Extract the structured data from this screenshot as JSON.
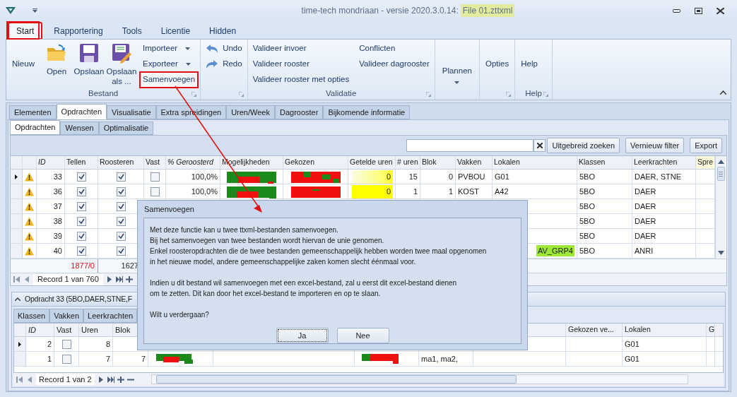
{
  "title_bar": {
    "title": "time-tech mondriaan - versie 2020.3.0.14:",
    "file": "File 01.zttxml"
  },
  "ribbon_tabs": [
    {
      "label": "Start",
      "selected": true
    },
    {
      "label": "Rapportering",
      "selected": false
    },
    {
      "label": "Tools",
      "selected": false
    },
    {
      "label": "Licentie",
      "selected": false
    },
    {
      "label": "Hidden",
      "selected": false
    }
  ],
  "ribbon_groups": [
    {
      "label": "Bestand",
      "launcher": true,
      "items": [
        {
          "kind": "text",
          "label": "Nieuw"
        },
        {
          "kind": "large",
          "label": "Open"
        },
        {
          "kind": "large",
          "label": "Opslaan"
        },
        {
          "kind": "large",
          "label": "Opslaan als ..."
        },
        {
          "kind": "stack",
          "entries": [
            {
              "label": "Importeer",
              "dropdown": true,
              "highlighted": false
            },
            {
              "label": "Exporteer",
              "dropdown": true,
              "highlighted": false
            },
            {
              "label": "Samenvoegen",
              "dropdown": false,
              "highlighted": true
            }
          ]
        }
      ]
    },
    {
      "launcher": true,
      "items": [
        {
          "kind": "stack",
          "entries": [
            {
              "label": "Undo",
              "dropdown": false,
              "highlighted": false
            },
            {
              "label": "Redo",
              "dropdown": false,
              "highlighted": false
            }
          ]
        }
      ]
    },
    {
      "label": "Validatie",
      "launcher": true,
      "items": [
        {
          "kind": "stack",
          "entries": [
            {
              "label": "Valideer invoer",
              "dropdown": false,
              "highlighted": false
            },
            {
              "label": "Valideer rooster",
              "dropdown": false,
              "highlighted": false
            },
            {
              "label": "Valideer rooster met opties",
              "dropdown": false,
              "highlighted": false
            }
          ]
        },
        {
          "kind": "stack",
          "entries": [
            {
              "label": "Conflicten",
              "dropdown": false,
              "highlighted": false
            },
            {
              "label": "Valideer dagrooster",
              "dropdown": false,
              "highlighted": false
            }
          ]
        }
      ]
    },
    {
      "launcher": false,
      "items": [
        {
          "kind": "dropdown",
          "label": "Plannen"
        }
      ]
    },
    {
      "launcher": true,
      "items": [
        {
          "kind": "text",
          "label": "Opties"
        }
      ]
    },
    {
      "label": "Help",
      "launcher": true,
      "items": [
        {
          "kind": "text",
          "label": "Help"
        }
      ]
    }
  ],
  "main_tabs": [
    {
      "label": "Elementen",
      "selected": false
    },
    {
      "label": "Opdrachten",
      "selected": true
    },
    {
      "label": "Visualisatie",
      "selected": false
    },
    {
      "label": "Extra spreidingen",
      "selected": false
    },
    {
      "label": "Uren/Week",
      "selected": false
    },
    {
      "label": "Dagrooster",
      "selected": false
    },
    {
      "label": "Bijkomende informatie",
      "selected": false
    }
  ],
  "sub_tabs": [
    {
      "label": "Opdrachten",
      "selected": true
    },
    {
      "label": "Wensen",
      "selected": false
    },
    {
      "label": "Optimalisatie",
      "selected": false
    }
  ],
  "toolbar": {
    "buttons": [
      "Uitgebreid zoeken",
      "Vernieuw filter",
      "Export"
    ]
  },
  "grid": {
    "columns": [
      {
        "label": "ID",
        "italic": true
      },
      {
        "label": "Tellen",
        "italic": false
      },
      {
        "label": "Roosteren",
        "italic": false
      },
      {
        "label": "Vast",
        "italic": false
      },
      {
        "label": "% Geroosterd",
        "italic": true
      },
      {
        "label": "Mogelijkheden",
        "italic": false
      },
      {
        "label": "Gekozen",
        "italic": false
      },
      {
        "label": "Getelde uren",
        "italic": false
      },
      {
        "label": "# uren",
        "italic": false
      },
      {
        "label": "Blok",
        "italic": false
      },
      {
        "label": "Vakken",
        "italic": false
      },
      {
        "label": "Lokalen",
        "italic": false
      },
      {
        "label": "Klassen",
        "italic": false
      },
      {
        "label": "Leerkrachten",
        "italic": false
      },
      {
        "label": "Spre",
        "italic": false
      }
    ],
    "rows": [
      {
        "current": true,
        "id": "33",
        "tellen": true,
        "roosteren": true,
        "vast": false,
        "pct": "100,0%",
        "getelde": "0",
        "getelde_warning": true,
        "uren": "15",
        "blok": "0",
        "vakken": "PVBOU",
        "lokalen": "G01",
        "lokalen_highlight": false,
        "klassen": "5BO",
        "leerkrachten": "DAER, STNE"
      },
      {
        "current": false,
        "id": "36",
        "tellen": true,
        "roosteren": true,
        "vast": false,
        "pct": "100,0%",
        "getelde": "0",
        "getelde_warning": true,
        "uren": "1",
        "blok": "1",
        "vakken": "KOST",
        "lokalen": "A42",
        "lokalen_highlight": false,
        "klassen": "5BO",
        "leerkrachten": "DAER"
      },
      {
        "current": false,
        "id": "37",
        "tellen": true,
        "roosteren": true,
        "klassen": "5BO",
        "leerkrachten": "DAER"
      },
      {
        "current": false,
        "id": "38",
        "tellen": true,
        "roosteren": true,
        "klassen": "5BO",
        "leerkrachten": "DAER"
      },
      {
        "current": false,
        "id": "39",
        "tellen": true,
        "roosteren": true,
        "klassen": "5BO",
        "leerkrachten": "DAER"
      },
      {
        "current": false,
        "id": "40",
        "tellen": true,
        "roosteren": true,
        "lokalen": "AV_GRP4",
        "lokalen_highlight": true,
        "klassen": "5BO",
        "leerkrachten": "ANRI"
      }
    ],
    "totals": {
      "tellen": "1877/0",
      "roosteren": "1627"
    },
    "navigator": "Record 1 van 760"
  },
  "detail": {
    "title": "Opdracht 33 (5BO,DAER,STNE,F",
    "tabs": [
      "Klassen",
      "Vakken",
      "Leerkrachten"
    ],
    "columns": [
      "ID",
      "Vast",
      "Uren",
      "Blok",
      "Gekozen ve...",
      "Lokalen",
      "G"
    ],
    "rows": [
      {
        "current": true,
        "id": "2",
        "vast": false,
        "uren": "8",
        "lokalen": "G01"
      },
      {
        "current": false,
        "id": "1",
        "vast": false,
        "uren": "7",
        "blok": "7",
        "vakken": "ma1, ma2,",
        "lokalen": "G01"
      }
    ],
    "navigator": "Record 1 van 2"
  },
  "dialog": {
    "title": "Samenvoegen",
    "paragraphs": [
      "Met deze functie kan u twee ttxml-bestanden samenvoegen.\nBij het samenvoegen van twee bestanden wordt hiervan de unie genomen.\nEnkel roosteropdrachten die de twee bestanden gemeenschappelijk hebben worden twee maal opgenomen\nin het nieuwe model, andere gemeenschappelijke zaken komen slecht éénmaal voor.",
      "Indien u dit bestand wil samenvoegen met een excel-bestand, zal u eerst dit excel-bestand dienen\nom te zetten. Dit kan door het excel-bestand te importeren en op te slaan.",
      "Wilt u verdergaan?"
    ],
    "buttons": [
      {
        "label": "Ja",
        "focused": true
      },
      {
        "label": "Nee",
        "focused": false
      }
    ]
  }
}
